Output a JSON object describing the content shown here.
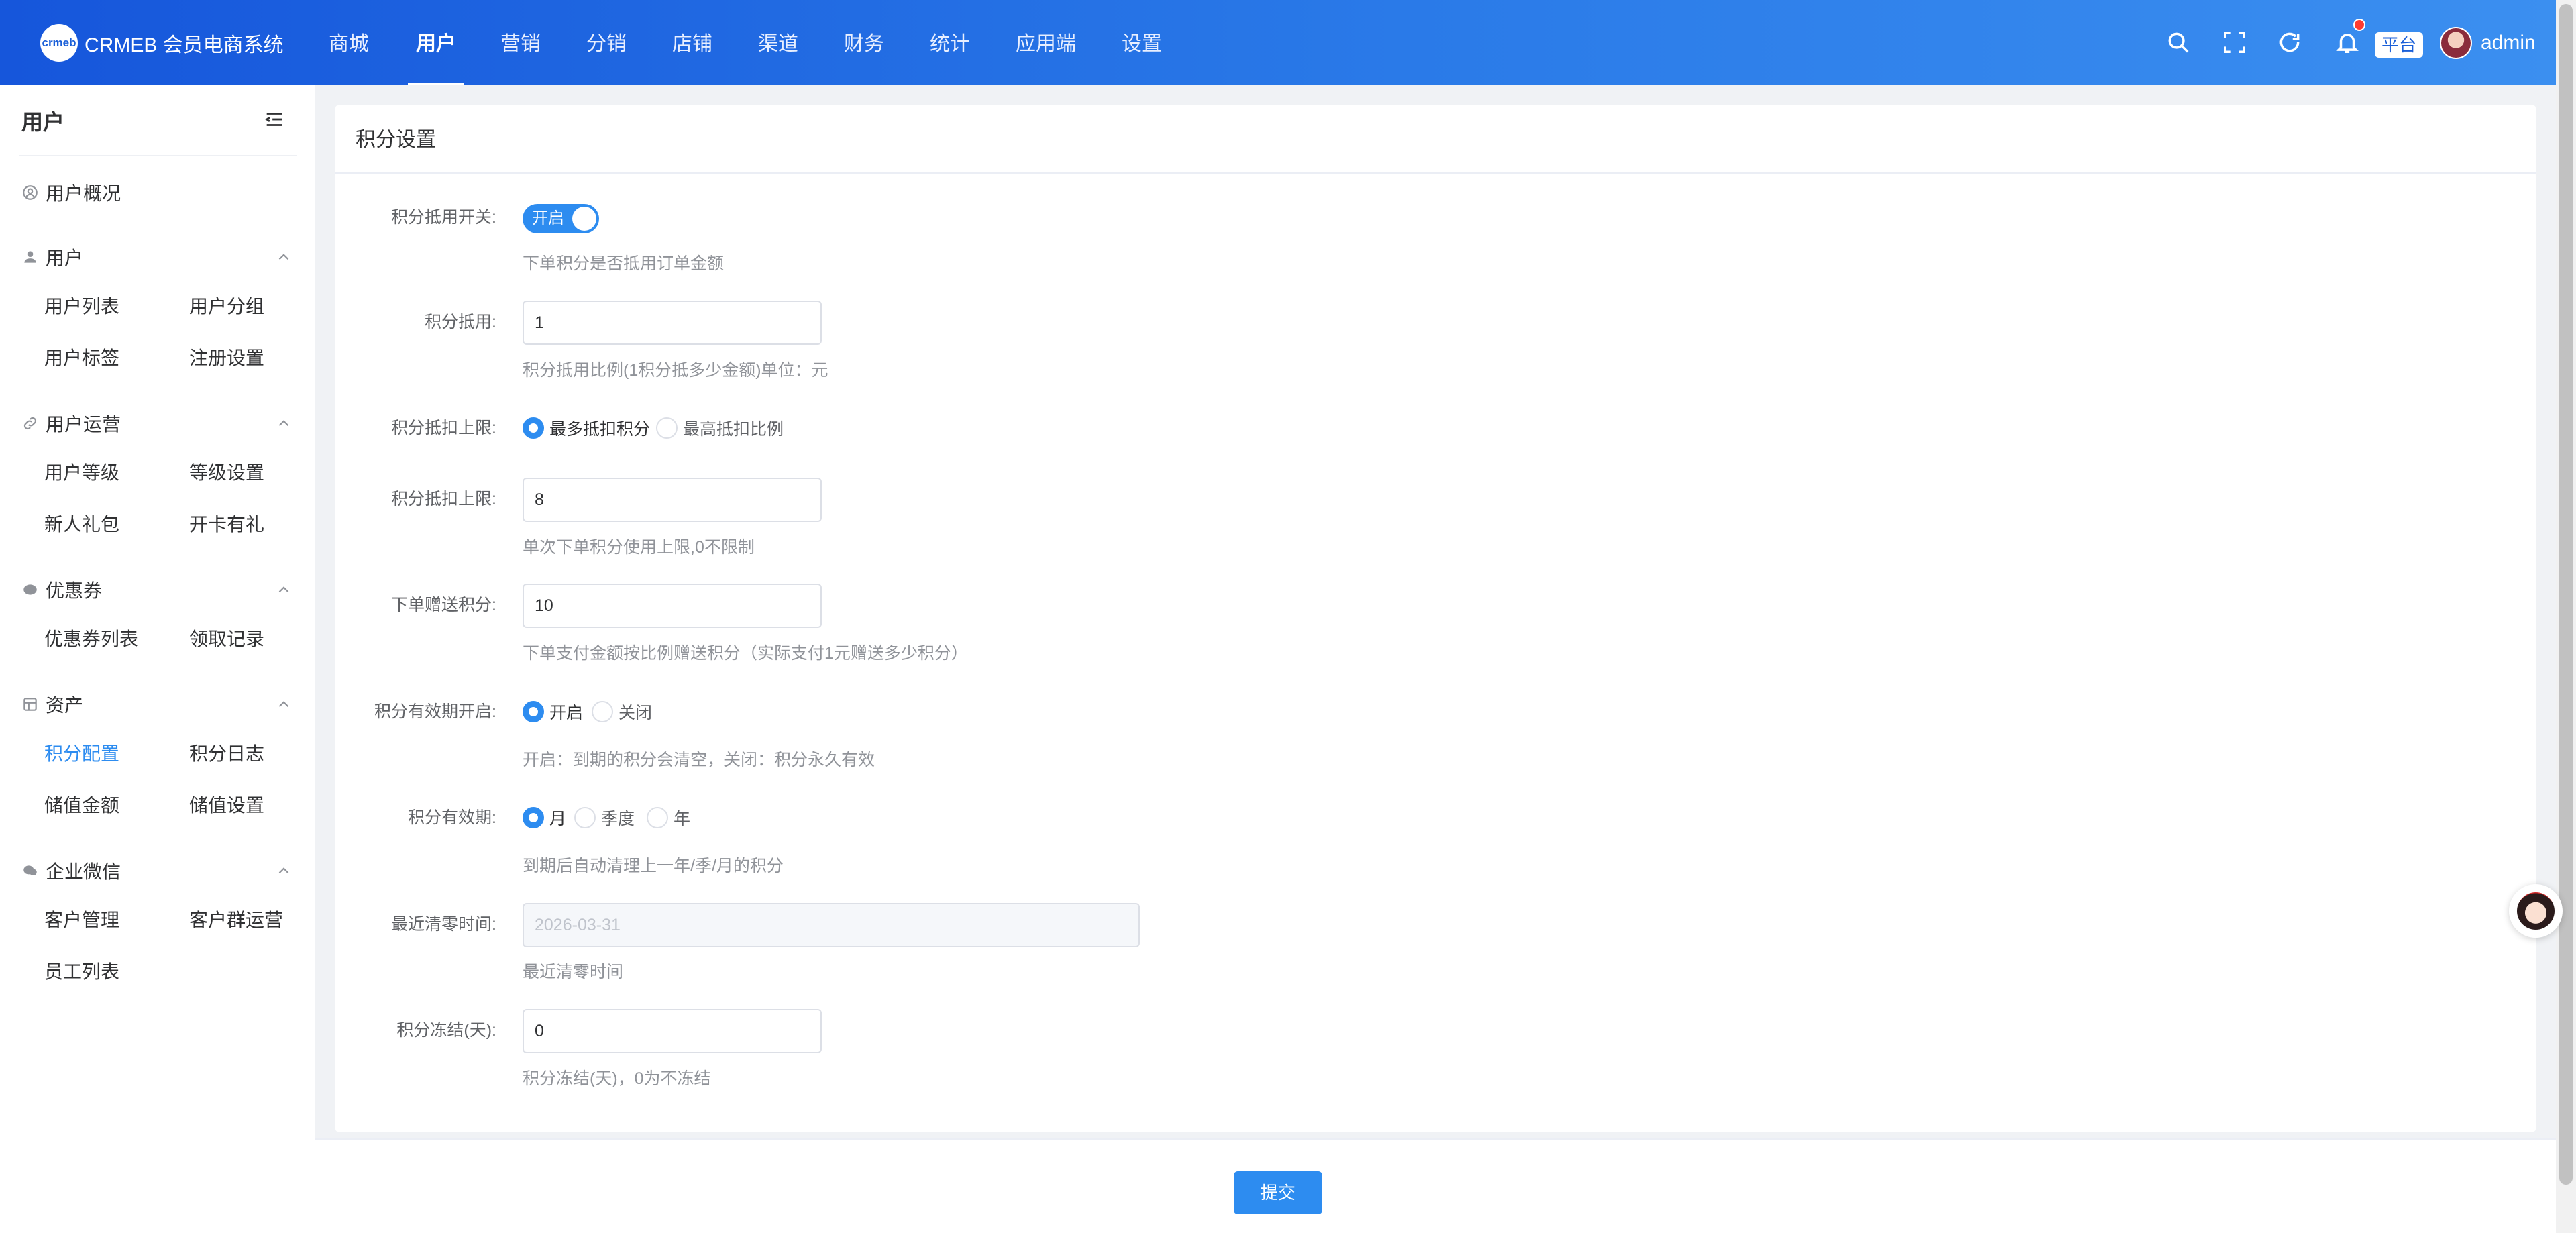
{
  "app": {
    "logo_mark": "crmeb",
    "title": "CRMEB 会员电商系统"
  },
  "topnav": [
    {
      "label": "商城"
    },
    {
      "label": "用户"
    },
    {
      "label": "营销"
    },
    {
      "label": "分销"
    },
    {
      "label": "店铺"
    },
    {
      "label": "渠道"
    },
    {
      "label": "财务"
    },
    {
      "label": "统计"
    },
    {
      "label": "应用端"
    },
    {
      "label": "设置"
    }
  ],
  "topnav_active": "用户",
  "topbar_icons": [
    "search-icon",
    "fullscreen-icon",
    "refresh-icon",
    "bell-icon"
  ],
  "header": {
    "platform_tag": "平台",
    "user": "admin"
  },
  "sidebar": {
    "title": "用户",
    "overview": "用户概况",
    "groups": [
      {
        "title": "用户",
        "icon": "user-icon",
        "items": [
          "用户列表",
          "用户分组",
          "用户标签",
          "注册设置"
        ]
      },
      {
        "title": "用户运营",
        "icon": "link-icon",
        "items": [
          "用户等级",
          "等级设置",
          "新人礼包",
          "开卡有礼"
        ]
      },
      {
        "title": "优惠券",
        "icon": "coupon-icon",
        "items": [
          "优惠券列表",
          "领取记录"
        ]
      },
      {
        "title": "资产",
        "icon": "asset-icon",
        "items": [
          "积分配置",
          "积分日志",
          "储值金额",
          "储值设置"
        ]
      },
      {
        "title": "企业微信",
        "icon": "wechat-icon",
        "items": [
          "客户管理",
          "客户群运营",
          "员工列表"
        ]
      }
    ],
    "active_item": "积分配置"
  },
  "card": {
    "title": "积分设置"
  },
  "form": {
    "switch": {
      "label": "积分抵用开关:",
      "state": "开启",
      "on": true,
      "hint": "下单积分是否抵用订单金额"
    },
    "ratio": {
      "label": "积分抵用:",
      "value": "1",
      "hint": "积分抵用比例(1积分抵多少金额)单位：元"
    },
    "limit_type": {
      "label": "积分抵扣上限:",
      "options": [
        "最多抵扣积分",
        "最高抵扣比例"
      ],
      "selected": 0
    },
    "limit": {
      "label": "积分抵扣上限:",
      "value": "8",
      "hint": "单次下单积分使用上限,0不限制"
    },
    "gift": {
      "label": "下单赠送积分:",
      "value": "10",
      "hint": "下单支付金额按比例赠送积分（实际支付1元赠送多少积分）"
    },
    "expire_switch": {
      "label": "积分有效期开启:",
      "options": [
        "开启",
        "关闭"
      ],
      "selected": 0,
      "hint": "开启：到期的积分会清空，关闭：积分永久有效"
    },
    "expire_period": {
      "label": "积分有效期:",
      "options": [
        "月",
        "季度",
        "年"
      ],
      "selected": 0,
      "hint": "到期后自动清理上一年/季/月的积分"
    },
    "clear_time": {
      "label": "最近清零时间:",
      "value": "2026-03-31",
      "hint": "最近清零时间"
    },
    "freeze": {
      "label": "积分冻结(天):",
      "value": "0",
      "hint": "积分冻结(天)，0为不冻结"
    }
  },
  "footer": {
    "submit_label": "提交"
  },
  "colors": {
    "primary": "#2d8cf0",
    "topbar_start": "#1656db",
    "topbar_end": "#3b8ff0",
    "notification_dot": "#ff3b30"
  }
}
